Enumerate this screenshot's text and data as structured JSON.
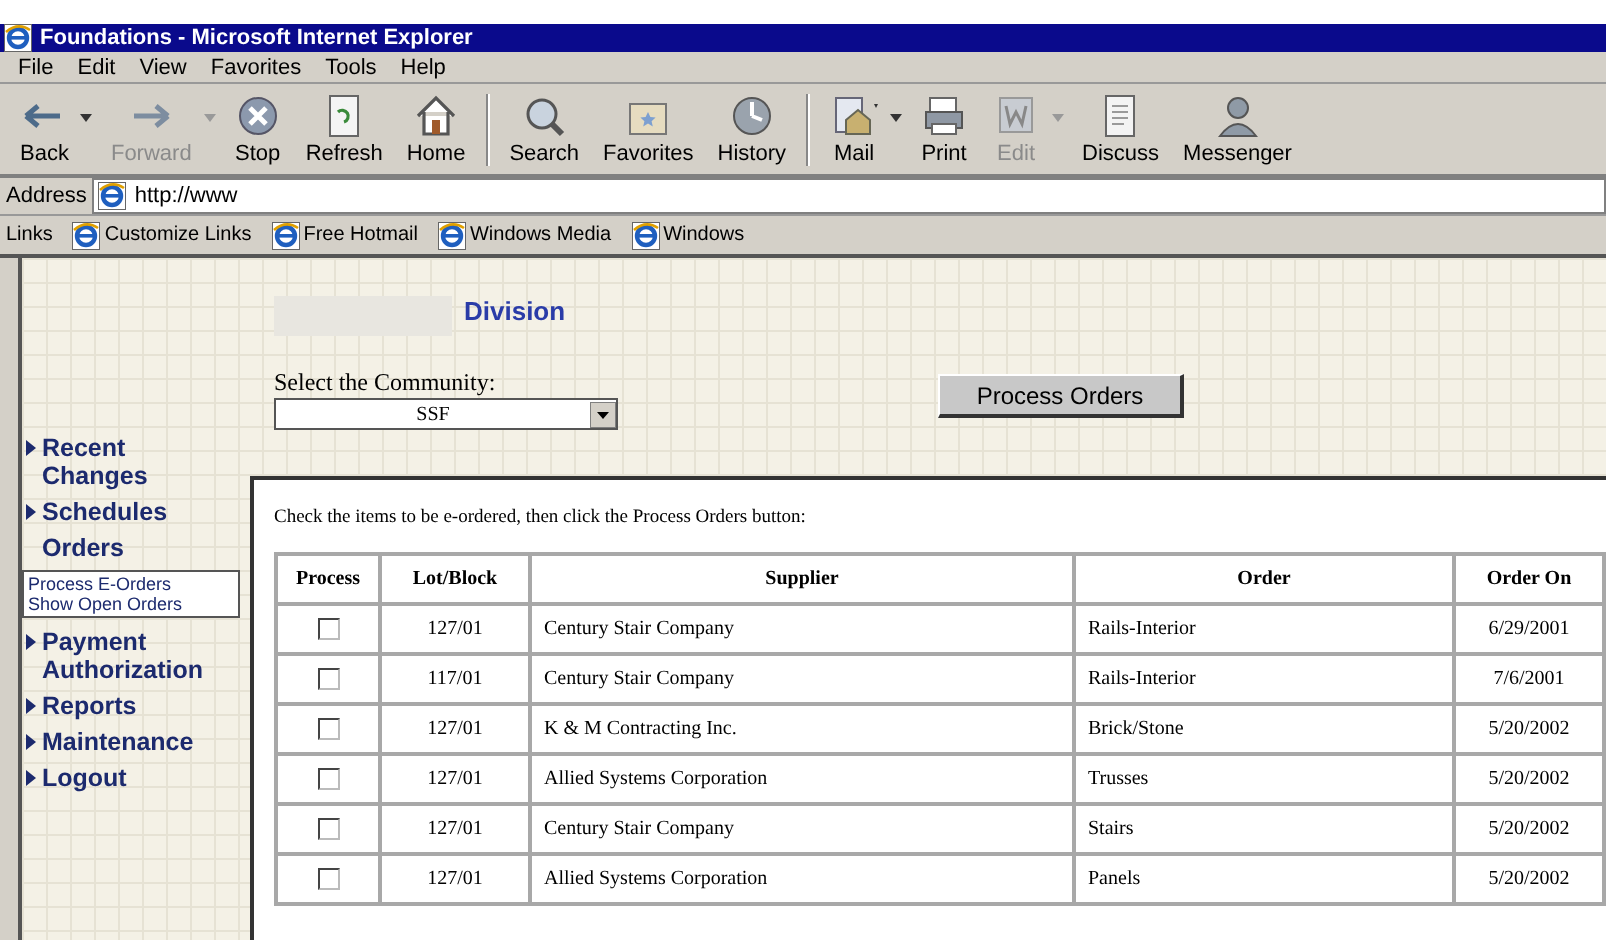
{
  "window": {
    "title": "Foundations - Microsoft Internet Explorer"
  },
  "menu": [
    "File",
    "Edit",
    "View",
    "Favorites",
    "Tools",
    "Help"
  ],
  "toolbar": [
    {
      "label": "Back",
      "disabled": false,
      "dropdown": true
    },
    {
      "label": "Forward",
      "disabled": true,
      "dropdown": true
    },
    {
      "label": "Stop",
      "disabled": false,
      "dropdown": false
    },
    {
      "label": "Refresh",
      "disabled": false,
      "dropdown": false
    },
    {
      "label": "Home",
      "disabled": false,
      "dropdown": false
    },
    {
      "label": "Search",
      "disabled": false,
      "dropdown": false
    },
    {
      "label": "Favorites",
      "disabled": false,
      "dropdown": false
    },
    {
      "label": "History",
      "disabled": false,
      "dropdown": false
    },
    {
      "label": "Mail",
      "disabled": false,
      "dropdown": true
    },
    {
      "label": "Print",
      "disabled": false,
      "dropdown": false
    },
    {
      "label": "Edit",
      "disabled": true,
      "dropdown": true
    },
    {
      "label": "Discuss",
      "disabled": false,
      "dropdown": false
    },
    {
      "label": "Messenger",
      "disabled": false,
      "dropdown": false
    }
  ],
  "address": {
    "label": "Address",
    "value": "http://www"
  },
  "links": {
    "label": "Links",
    "items": [
      "Customize Links",
      "Free Hotmail",
      "Windows Media",
      "Windows"
    ]
  },
  "heading": "Division",
  "community": {
    "label": "Select the Community:",
    "value": "SSF"
  },
  "process_button": "Process Orders",
  "sidebar": [
    {
      "label": "Recent Changes",
      "expanded": false
    },
    {
      "label": "Schedules",
      "expanded": false
    },
    {
      "label": "Orders",
      "expanded": true,
      "children": [
        "Process E-Orders",
        "Show Open Orders"
      ]
    },
    {
      "label": "Payment Authorization",
      "expanded": false
    },
    {
      "label": "Reports",
      "expanded": false
    },
    {
      "label": "Maintenance",
      "expanded": false
    },
    {
      "label": "Logout",
      "expanded": false
    }
  ],
  "instructions": "Check the items to be e-ordered, then click the Process Orders button:",
  "table": {
    "columns": [
      "Process",
      "Lot/Block",
      "Supplier",
      "Order",
      "Order On"
    ],
    "rows": [
      {
        "cells": [
          {
            "kind": "checkbox",
            "checked": false
          },
          {
            "kind": "text",
            "text": "127/01"
          },
          {
            "kind": "text",
            "text": "Century Stair Company"
          },
          {
            "kind": "text",
            "text": "Rails-Interior"
          },
          {
            "kind": "text",
            "text": "6/29/2001"
          }
        ]
      },
      {
        "cells": [
          {
            "kind": "checkbox",
            "checked": false
          },
          {
            "kind": "text",
            "text": "117/01"
          },
          {
            "kind": "text",
            "text": "Century Stair Company"
          },
          {
            "kind": "text",
            "text": "Rails-Interior"
          },
          {
            "kind": "text",
            "text": "7/6/2001"
          }
        ]
      },
      {
        "cells": [
          {
            "kind": "checkbox",
            "checked": false
          },
          {
            "kind": "text",
            "text": "127/01"
          },
          {
            "kind": "text",
            "text": "K & M Contracting Inc."
          },
          {
            "kind": "text",
            "text": "Brick/Stone"
          },
          {
            "kind": "text",
            "text": "5/20/2002"
          }
        ]
      },
      {
        "cells": [
          {
            "kind": "checkbox",
            "checked": false
          },
          {
            "kind": "text",
            "text": "127/01"
          },
          {
            "kind": "text",
            "text": "Allied Systems Corporation"
          },
          {
            "kind": "text",
            "text": "Trusses"
          },
          {
            "kind": "text",
            "text": "5/20/2002"
          }
        ]
      },
      {
        "cells": [
          {
            "kind": "checkbox",
            "checked": false
          },
          {
            "kind": "text",
            "text": "127/01"
          },
          {
            "kind": "text",
            "text": "Century Stair Company"
          },
          {
            "kind": "text",
            "text": "Stairs"
          },
          {
            "kind": "text",
            "text": "5/20/2002"
          }
        ]
      },
      {
        "cells": [
          {
            "kind": "checkbox",
            "checked": false
          },
          {
            "kind": "text",
            "text": "127/01"
          },
          {
            "kind": "text",
            "text": "Allied Systems Corporation"
          },
          {
            "kind": "text",
            "text": "Panels"
          },
          {
            "kind": "text",
            "text": "5/20/2002"
          }
        ]
      }
    ]
  }
}
